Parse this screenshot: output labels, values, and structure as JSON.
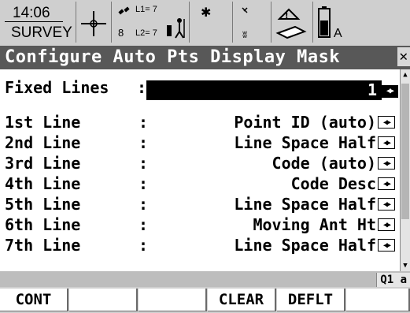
{
  "status": {
    "time": "14:06",
    "mode": "SURVEY",
    "l1": "L1= 7",
    "l2": "L2= 7",
    "sat_count": "8",
    "letter": "A"
  },
  "title": "Configure Auto Pts Display Mask",
  "fixed_lines": {
    "label": "Fixed Lines",
    "colon": ":",
    "value": "1"
  },
  "lines": [
    {
      "label": "1st Line",
      "colon": ":",
      "value": "Point ID (auto)"
    },
    {
      "label": "2nd Line",
      "colon": ":",
      "value": "Line Space Half"
    },
    {
      "label": "3rd Line",
      "colon": ":",
      "value": "Code (auto)"
    },
    {
      "label": "4th Line",
      "colon": ":",
      "value": "Code Desc"
    },
    {
      "label": "5th Line",
      "colon": ":",
      "value": "Line Space Half"
    },
    {
      "label": "6th Line",
      "colon": ":",
      "value": "Moving Ant Ht"
    },
    {
      "label": "7th Line",
      "colon": ":",
      "value": "Line Space Half"
    }
  ],
  "info_bar": {
    "indicator": "Q1 a"
  },
  "fkeys": [
    {
      "label": "CONT"
    },
    {
      "label": ""
    },
    {
      "label": ""
    },
    {
      "label": "CLEAR"
    },
    {
      "label": "DEFLT"
    },
    {
      "label": ""
    }
  ],
  "icons": [
    "crosshair-icon",
    "satellite-icon",
    "rover-person-icon",
    "bluetooth-icon",
    "radio-link-icon",
    "memory-card-icon",
    "battery-icon"
  ]
}
